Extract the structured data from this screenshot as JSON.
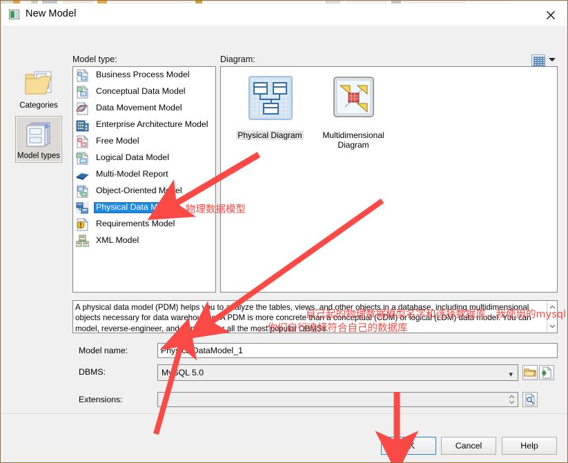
{
  "window": {
    "title": "New Model",
    "title_icon": "app-icon",
    "close_label": "close-icon"
  },
  "panes": {
    "model_type_label": "Model type:",
    "diagram_label": "Diagram:",
    "view_options_icon": "list-view-icon"
  },
  "rail": {
    "items": [
      {
        "label": "Categories",
        "icon": "categories-folder-icon",
        "selected": false
      },
      {
        "label": "Model types",
        "icon": "model-types-stack-icon",
        "selected": true
      }
    ]
  },
  "model_types": {
    "items": [
      {
        "label": "Business Process Model",
        "icon": "business-process-model-icon",
        "selected": false
      },
      {
        "label": "Conceptual Data Model",
        "icon": "conceptual-data-model-icon",
        "selected": false
      },
      {
        "label": "Data Movement Model",
        "icon": "data-movement-model-icon",
        "selected": false
      },
      {
        "label": "Enterprise Architecture Model",
        "icon": "enterprise-architecture-model-icon",
        "selected": false
      },
      {
        "label": "Free Model",
        "icon": "free-model-icon",
        "selected": false
      },
      {
        "label": "Logical Data Model",
        "icon": "logical-data-model-icon",
        "selected": false
      },
      {
        "label": "Multi-Model Report",
        "icon": "multi-model-report-icon",
        "selected": false
      },
      {
        "label": "Object-Oriented Model",
        "icon": "object-oriented-model-icon",
        "selected": false
      },
      {
        "label": "Physical Data Model",
        "icon": "physical-data-model-icon",
        "selected": true
      },
      {
        "label": "Requirements Model",
        "icon": "requirements-model-icon",
        "selected": false
      },
      {
        "label": "XML Model",
        "icon": "xml-model-icon",
        "selected": false
      }
    ]
  },
  "diagrams": {
    "items": [
      {
        "label": "Physical Diagram",
        "icon": "physical-diagram-icon",
        "selected": true
      },
      {
        "label": "Multidimensional Diagram",
        "icon": "multidimensional-diagram-icon",
        "selected": false
      }
    ]
  },
  "description": {
    "text": "A physical data model (PDM) helps you to analyze the tables, views, and other objects in a database, including multidimensional objects necessary for data warehousing. A PDM is more concrete than a conceptual (CDM) or logical (LDM) data model. You can model, reverse-engineer, and generate for all the most popular DBMSs."
  },
  "form": {
    "model_name": {
      "label": "Model name:",
      "value": "PhysicalDataModel_1",
      "placeholder": ""
    },
    "dbms": {
      "label": "DBMS:",
      "value": "MySQL 5.0",
      "browse_icon": "folder-open-icon",
      "add_icon": "new-file-icon"
    },
    "extensions": {
      "label": "Extensions:",
      "value": "",
      "placeholder": "",
      "browse_icon": "document-search-icon"
    }
  },
  "footer": {
    "ok": "OK",
    "cancel": "Cancel",
    "help": "Help"
  },
  "annotations": {
    "model_type_note": "物理数据模型",
    "name_note_line1": "自己起的物理数据模型名字和选择数据库，我使用的mysql",
    "name_note_line2": "，你们自行选择符合自己的数据库",
    "arrow_color": "#fb4a45"
  },
  "colors": {
    "selection_blue": "#1f8ae0",
    "dialog_bg": "#f0f0f0",
    "annotation_red": "#fb4a45",
    "focus_blue": "#1a7fd4",
    "window_border": "#9a6a30"
  }
}
